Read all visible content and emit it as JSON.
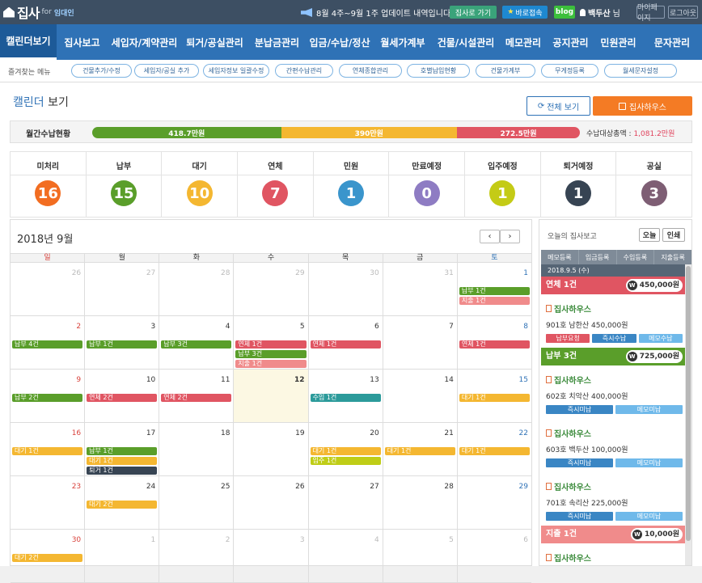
{
  "topbar": {
    "brand": "집사",
    "for_text": "for",
    "landlord": "임대인",
    "notice": "8월 4주~9월 1주 업데이트 내역입니다~",
    "btn_green": "집사로 가기",
    "btn_blue": "바로접속",
    "btn_blog": "blog",
    "user_name": "백두산",
    "user_suffix": "님",
    "btn_mypage": "마이페이지",
    "btn_logout": "로그아웃"
  },
  "nav": [
    {
      "label": "캘린더보기",
      "w": 70,
      "active": true
    },
    {
      "label": "집사보고",
      "w": 63
    },
    {
      "label": "세입자/계약관리",
      "w": 91
    },
    {
      "label": "퇴거/공실관리",
      "w": 83
    },
    {
      "label": "분납금관리",
      "w": 71
    },
    {
      "label": "입금/수납/정산",
      "w": 84
    },
    {
      "label": "월세가계부",
      "w": 72
    },
    {
      "label": "건물/시설관리",
      "w": 84
    },
    {
      "label": "메모관리",
      "w": 58
    },
    {
      "label": "공지관리",
      "w": 59
    },
    {
      "label": "민원관리",
      "w": 59
    },
    {
      "label": "문자관리",
      "w": 74
    }
  ],
  "favorites": {
    "label": "즐겨찾는 메뉴",
    "items": [
      "건물추가/수정",
      "세입자/공실 추가",
      "세입자정보 일괄수정",
      "간편수납관리",
      "연체종합관리",
      "호별납입현황",
      "건물가계부",
      "무게정등록",
      "월세문자설정"
    ]
  },
  "page": {
    "title_blue": "캘린더",
    "title_rest": " 보기",
    "btn_all": "전체 보기",
    "btn_select": "집사하우스"
  },
  "summary": {
    "label": "월간수납현황",
    "total_label": "수납대상총액 : ",
    "total_value": "1,081.2만원"
  },
  "summary_bar": [
    {
      "label": "418.7만원",
      "value": 418.7,
      "color": "#5a9e2a"
    },
    {
      "label": "390만원",
      "value": 390,
      "color": "#f4b731"
    },
    {
      "label": "272.5만원",
      "value": 272.5,
      "color": "#e05562"
    }
  ],
  "stats": [
    {
      "label": "미처리",
      "value": "16",
      "color": "#f26d21"
    },
    {
      "label": "납부",
      "value": "15",
      "color": "#5a9e2a"
    },
    {
      "label": "대기",
      "value": "10",
      "color": "#f4b731"
    },
    {
      "label": "연체",
      "value": "7",
      "color": "#e05562"
    },
    {
      "label": "민원",
      "value": "1",
      "color": "#3a95cc"
    },
    {
      "label": "만료예정",
      "value": "0",
      "color": "#8e7cc3"
    },
    {
      "label": "입주예정",
      "value": "1",
      "color": "#c4cb16"
    },
    {
      "label": "퇴거예정",
      "value": "1",
      "color": "#374453"
    },
    {
      "label": "공실",
      "value": "3",
      "color": "#7e5e74"
    }
  ],
  "calendar": {
    "title": "2018년 9월",
    "prev": "‹",
    "next": "›",
    "daynames": [
      "일",
      "월",
      "화",
      "수",
      "목",
      "금",
      "토"
    ],
    "weeks": [
      [
        {
          "d": "26",
          "o": true,
          "ev": []
        },
        {
          "d": "27",
          "o": true,
          "ev": []
        },
        {
          "d": "28",
          "o": true,
          "ev": []
        },
        {
          "d": "29",
          "o": true,
          "ev": []
        },
        {
          "d": "30",
          "o": true,
          "ev": []
        },
        {
          "d": "31",
          "o": true,
          "ev": []
        },
        {
          "d": "1",
          "ev": [
            {
              "t": "납부 1건",
              "c": "green"
            },
            {
              "t": "지출 1건",
              "c": "salmon"
            }
          ]
        }
      ],
      [
        {
          "d": "2",
          "ev": [
            {
              "t": "납부 4건",
              "c": "green"
            }
          ]
        },
        {
          "d": "3",
          "ev": [
            {
              "t": "납부 1건",
              "c": "green"
            }
          ]
        },
        {
          "d": "4",
          "ev": [
            {
              "t": "납부 3건",
              "c": "green"
            }
          ]
        },
        {
          "d": "5",
          "ev": [
            {
              "t": "연체 1건",
              "c": "red"
            },
            {
              "t": "납부 3건",
              "c": "green"
            },
            {
              "t": "지출 1건",
              "c": "salmon"
            }
          ]
        },
        {
          "d": "6",
          "ev": [
            {
              "t": "연체 1건",
              "c": "red"
            }
          ]
        },
        {
          "d": "7",
          "ev": []
        },
        {
          "d": "8",
          "ev": [
            {
              "t": "연체 1건",
              "c": "red"
            }
          ]
        }
      ],
      [
        {
          "d": "9",
          "ev": [
            {
              "t": "납부 2건",
              "c": "green"
            }
          ]
        },
        {
          "d": "10",
          "ev": [
            {
              "t": "연체 2건",
              "c": "red"
            }
          ]
        },
        {
          "d": "11",
          "ev": [
            {
              "t": "연체 2건",
              "c": "red"
            }
          ]
        },
        {
          "d": "12",
          "today": true,
          "ev": []
        },
        {
          "d": "13",
          "ev": [
            {
              "t": "수입 1건",
              "c": "teal"
            }
          ]
        },
        {
          "d": "14",
          "ev": []
        },
        {
          "d": "15",
          "ev": [
            {
              "t": "대기 1건",
              "c": "yellow"
            }
          ]
        }
      ],
      [
        {
          "d": "16",
          "ev": [
            {
              "t": "대기 1건",
              "c": "yellow"
            }
          ]
        },
        {
          "d": "17",
          "ev": [
            {
              "t": "납부 1건",
              "c": "green"
            },
            {
              "t": "대기 1건",
              "c": "yellow"
            },
            {
              "t": "퇴거 1건",
              "c": "dark"
            }
          ]
        },
        {
          "d": "18",
          "ev": []
        },
        {
          "d": "19",
          "ev": []
        },
        {
          "d": "20",
          "ev": [
            {
              "t": "대기 1건",
              "c": "yellow"
            },
            {
              "t": "입주 1건",
              "c": "lime"
            }
          ]
        },
        {
          "d": "21",
          "ev": [
            {
              "t": "대기 1건",
              "c": "yellow"
            }
          ]
        },
        {
          "d": "22",
          "ev": [
            {
              "t": "대기 1건",
              "c": "yellow"
            }
          ]
        }
      ],
      [
        {
          "d": "23",
          "ev": []
        },
        {
          "d": "24",
          "ev": [
            {
              "t": "대기 2건",
              "c": "yellow"
            }
          ]
        },
        {
          "d": "25",
          "ev": []
        },
        {
          "d": "26",
          "ev": []
        },
        {
          "d": "27",
          "ev": []
        },
        {
          "d": "28",
          "ev": []
        },
        {
          "d": "29",
          "ev": []
        }
      ],
      [
        {
          "d": "30",
          "ev": [
            {
              "t": "대기 2건",
              "c": "yellow"
            }
          ]
        },
        {
          "d": "1",
          "o": true,
          "ev": []
        },
        {
          "d": "2",
          "o": true,
          "ev": []
        },
        {
          "d": "3",
          "o": true,
          "ev": []
        },
        {
          "d": "4",
          "o": true,
          "ev": []
        },
        {
          "d": "5",
          "o": true,
          "ev": []
        },
        {
          "d": "6",
          "o": true,
          "ev": []
        }
      ]
    ]
  },
  "side": {
    "title": "오늘의 집사보고",
    "btn_today": "오늘",
    "btn_print": "인쇄",
    "tabs": [
      "메모등록",
      "입금등록",
      "수입등록",
      "지출등록"
    ],
    "date": "2018.9.5 (수)",
    "groups": [
      {
        "head": "연체 1건",
        "amount": "450,000원",
        "color": "#e05562",
        "cards": [
          {
            "name": "집사하우스",
            "desc": "901호 남한산 450,000원",
            "btns": [
              {
                "t": "납부요청",
                "c": "pink"
              },
              {
                "t": "즉시수납",
                "c": "blue"
              },
              {
                "t": "메모수납",
                "c": "sky"
              }
            ]
          }
        ]
      },
      {
        "head": "납부 3건",
        "amount": "725,000원",
        "color": "#5a9e2a",
        "cards": [
          {
            "name": "집사하우스",
            "desc": "602호 치악산 400,000원",
            "btns": [
              {
                "t": "즉시미납",
                "c": "blue"
              },
              {
                "t": "메모미납",
                "c": "sky"
              }
            ]
          },
          {
            "name": "집사하우스",
            "desc": "603호 백두산 100,000원",
            "btns": [
              {
                "t": "즉시미납",
                "c": "blue"
              },
              {
                "t": "메모미납",
                "c": "sky"
              }
            ]
          },
          {
            "name": "집사하우스",
            "desc": "701호 속리산 225,000원",
            "btns": [
              {
                "t": "즉시미납",
                "c": "blue"
              },
              {
                "t": "메모미납",
                "c": "sky"
              }
            ]
          }
        ]
      },
      {
        "head": "지출 1건",
        "amount": "10,000원",
        "color": "#f08b8b",
        "cards": [
          {
            "name": "집사하우스",
            "desc": "",
            "btns": []
          }
        ]
      }
    ],
    "w_mark": "W"
  }
}
